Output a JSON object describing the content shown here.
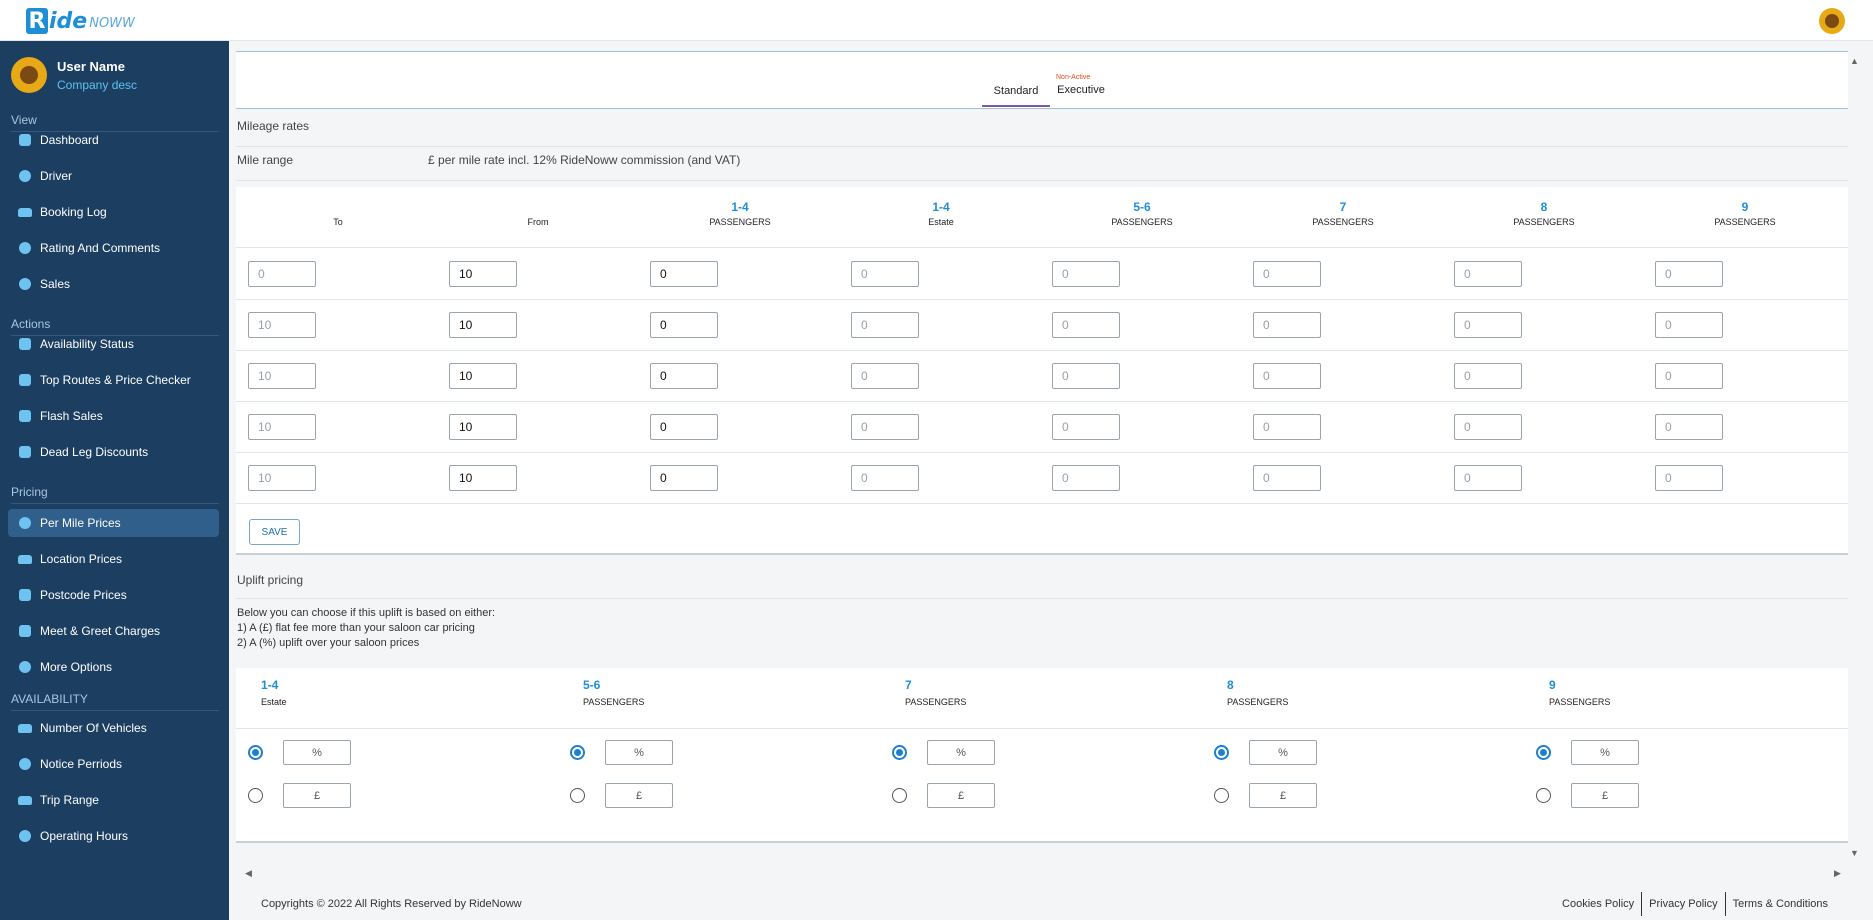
{
  "header": {
    "logo_r": "R",
    "logo_ide": "ide",
    "logo_noww": "NOWW"
  },
  "user": {
    "name": "User Name",
    "desc": "Company desc"
  },
  "sidebar": {
    "sections": {
      "view": "View",
      "actions": "Actions",
      "pricing": "Pricing",
      "availability": "AVAILABILITY"
    },
    "items": [
      {
        "label": "Dashboard",
        "icon": "dashboard-icon"
      },
      {
        "label": "Driver",
        "icon": "driver-icon"
      },
      {
        "label": "Booking Log",
        "icon": "booking-log-icon"
      },
      {
        "label": "Rating And Comments",
        "icon": "rating-icon"
      },
      {
        "label": "Sales",
        "icon": "sales-icon"
      },
      {
        "label": "Availability Status",
        "icon": "availability-status-icon"
      },
      {
        "label": "Top Routes & Price Checker",
        "icon": "price-checker-icon"
      },
      {
        "label": "Flash Sales",
        "icon": "flash-sales-icon"
      },
      {
        "label": "Dead Leg Discounts",
        "icon": "dead-leg-icon"
      },
      {
        "label": "Per Mile Prices",
        "icon": "dollar-icon",
        "active": true
      },
      {
        "label": "Location Prices",
        "icon": "location-prices-icon"
      },
      {
        "label": "Postcode Prices",
        "icon": "postcode-prices-icon"
      },
      {
        "label": "Meet & Greet Charges",
        "icon": "meet-greet-icon"
      },
      {
        "label": "More Options",
        "icon": "more-options-icon"
      },
      {
        "label": "Number Of Vehicles",
        "icon": "car-icon"
      },
      {
        "label": "Notice Perriods",
        "icon": "notice-icon"
      },
      {
        "label": "Trip Range",
        "icon": "trip-range-icon"
      },
      {
        "label": "Operating Hours",
        "icon": "clock-icon"
      }
    ]
  },
  "tabs": {
    "standard": "Standard",
    "executive": "Executive",
    "executive_badge": "Non-Active"
  },
  "mileage": {
    "title": "Mileage rates",
    "mile_range": "Mile range",
    "rate_desc": "£ per mile rate incl. 12% RideNoww commission (and VAT)",
    "columns": [
      {
        "num": "",
        "sub": "To"
      },
      {
        "num": "",
        "sub": "From"
      },
      {
        "num": "1-4",
        "sub": "PASSENGERS"
      },
      {
        "num": "1-4",
        "sub": "Estate"
      },
      {
        "num": "5-6",
        "sub": "PASSENGERS"
      },
      {
        "num": "7",
        "sub": "PASSENGERS"
      },
      {
        "num": "8",
        "sub": "PASSENGERS"
      },
      {
        "num": "9",
        "sub": "PASSENGERS"
      }
    ],
    "rows": [
      [
        "0",
        "10",
        "0",
        "0",
        "0",
        "0",
        "0",
        "0"
      ],
      [
        "10",
        "10",
        "0",
        "0",
        "0",
        "0",
        "0",
        "0"
      ],
      [
        "10",
        "10",
        "0",
        "0",
        "0",
        "0",
        "0",
        "0"
      ],
      [
        "10",
        "10",
        "0",
        "0",
        "0",
        "0",
        "0",
        "0"
      ],
      [
        "10",
        "10",
        "0",
        "0",
        "0",
        "0",
        "0",
        "0"
      ]
    ],
    "save_label": "SAVE"
  },
  "uplift": {
    "title": "Uplift pricing",
    "desc_line1": "Below you can choose if this uplift is based on either:",
    "desc_line2": "1) A (£) flat fee more than your saloon car pricing",
    "desc_line3": "2) A (%) uplift over your saloon prices",
    "percent_symbol": "%",
    "pound_symbol": "£",
    "columns": [
      {
        "num": "1-4",
        "sub": "Estate"
      },
      {
        "num": "5-6",
        "sub": "PASSENGERS"
      },
      {
        "num": "7",
        "sub": "PASSENGERS"
      },
      {
        "num": "8",
        "sub": "PASSENGERS"
      },
      {
        "num": "9",
        "sub": "PASSENGERS"
      }
    ]
  },
  "footer": {
    "copyright": "Copyrights © 2022 All Rights Reserved by RideNoww",
    "cookies": "Cookies Policy",
    "privacy": "Privacy Policy",
    "terms": "Terms & Conditions"
  }
}
